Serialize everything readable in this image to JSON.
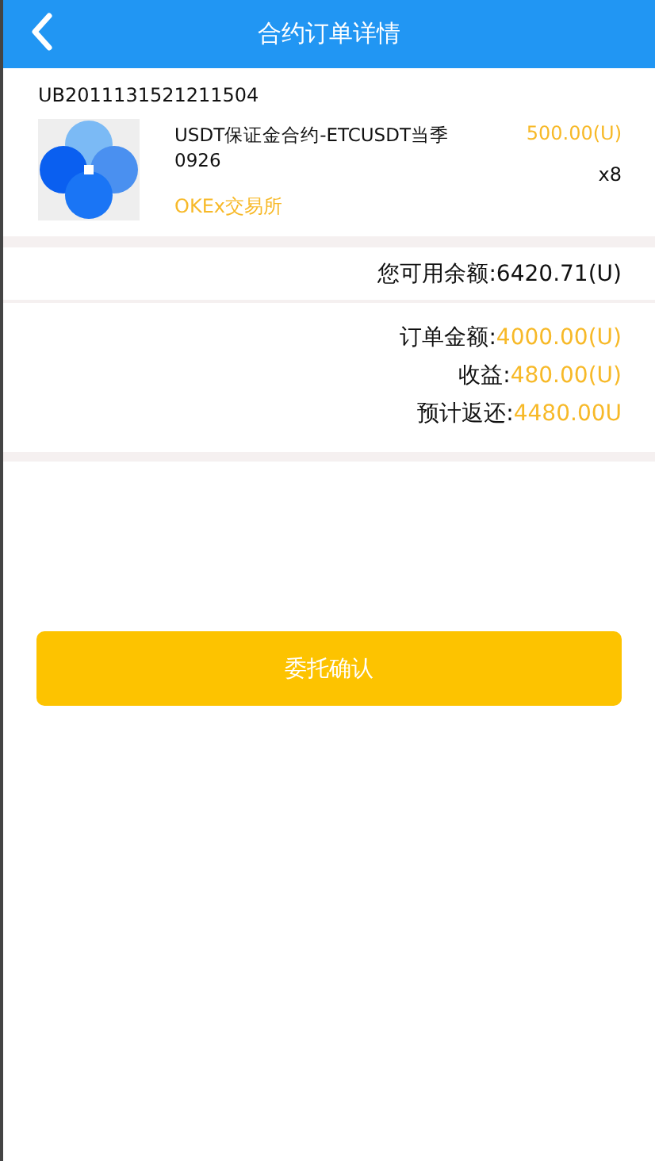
{
  "header": {
    "title": "合约订单详情"
  },
  "order": {
    "number": "UB2011131521211504",
    "product": {
      "title": "USDT保证金合约-ETCUSDT当季0926",
      "price": "500.00(U)",
      "quantity": "x8",
      "exchange": "OKEx交易所"
    }
  },
  "balance": {
    "label": "您可用余额:",
    "value": "6420.71(U)"
  },
  "summary": [
    {
      "label": "订单金额:",
      "value": "4000.00(U)"
    },
    {
      "label": "收益:",
      "value": "480.00(U)"
    },
    {
      "label": "预计返还:",
      "value": "4480.00U"
    }
  ],
  "confirm_button": "委托确认"
}
